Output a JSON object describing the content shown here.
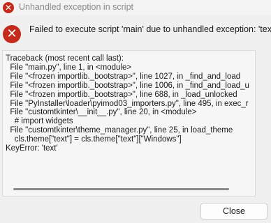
{
  "window": {
    "title": "Unhandled exception in script",
    "icon": "error-icon",
    "error_color": "#c42b1c"
  },
  "dialog": {
    "message": "Failed to execute script 'main' due to unhandled exception: 'text'",
    "icon": "error-icon"
  },
  "traceback": {
    "lines": [
      "Traceback (most recent call last):",
      "  File \"main.py\", line 1, in <module>",
      "  File \"<frozen importlib._bootstrap>\", line 1027, in _find_and_load",
      "  File \"<frozen importlib._bootstrap>\", line 1006, in _find_and_load_u",
      "  File \"<frozen importlib._bootstrap>\", line 688, in _load_unlocked",
      "  File \"PyInstaller\\loader\\pyimod03_importers.py\", line 495, in exec_r",
      "  File \"customtkinter\\__init__.py\", line 20, in <module>",
      "    # import widgets",
      "  File \"customtkinter\\theme_manager.py\", line 25, in load_theme",
      "    cls.theme[\"text\"] = cls.theme[\"text\"][\"Windows\"]",
      "KeyError: 'text'"
    ]
  },
  "buttons": {
    "close_label": "Close"
  }
}
